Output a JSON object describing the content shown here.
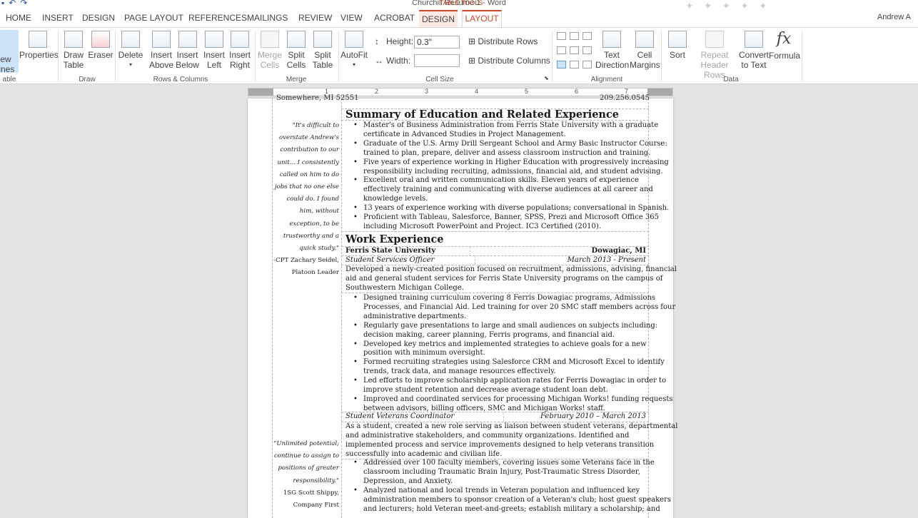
{
  "window": {
    "title": "Churchill Resume 1 - Word",
    "context_group": "TABLE TOOLS",
    "user": "Andrew A"
  },
  "quick_access_icons": [
    "save-icon",
    "undo-icon",
    "redo-icon"
  ],
  "tabs": [
    "HOME",
    "INSERT",
    "DESIGN",
    "PAGE LAYOUT",
    "REFERENCES",
    "MAILINGS",
    "REVIEW",
    "VIEW",
    "ACROBAT",
    "DESIGN",
    "LAYOUT"
  ],
  "active_tab": "LAYOUT",
  "accent_color": "#d24726",
  "ribbon": {
    "table": {
      "view_gridlines_l1": "ew",
      "view_gridlines_l2": "lines",
      "properties": "Properties",
      "group": "able"
    },
    "draw": {
      "draw_table_l1": "Draw",
      "draw_table_l2": "Table",
      "eraser": "Eraser",
      "group": "Draw"
    },
    "rows_columns": {
      "delete": "Delete",
      "insert_above_l1": "Insert",
      "insert_above_l2": "Above",
      "insert_below_l1": "Insert",
      "insert_below_l2": "Below",
      "insert_left_l1": "Insert",
      "insert_left_l2": "Left",
      "insert_right_l1": "Insert",
      "insert_right_l2": "Right",
      "group": "Rows & Columns"
    },
    "merge": {
      "merge_cells_l1": "Merge",
      "merge_cells_l2": "Cells",
      "split_cells_l1": "Split",
      "split_cells_l2": "Cells",
      "split_table_l1": "Split",
      "split_table_l2": "Table",
      "group": "Merge"
    },
    "cell_size": {
      "autofit": "AutoFit",
      "height_label": "Height:",
      "height_value": "0.3\"",
      "width_label": "Width:",
      "width_value": "",
      "distribute_rows": "Distribute Rows",
      "distribute_columns": "Distribute Columns",
      "group": "Cell Size"
    },
    "alignment": {
      "text_direction_l1": "Text",
      "text_direction_l2": "Direction",
      "cell_margins_l1": "Cell",
      "cell_margins_l2": "Margins",
      "group": "Alignment"
    },
    "data": {
      "sort": "Sort",
      "repeat_header_l1": "Repeat",
      "repeat_header_l2": "Header Rows",
      "convert_l1": "Convert",
      "convert_l2": "to Text",
      "formula": "Formula",
      "group": "Data"
    }
  },
  "ruler": {
    "numbers": [
      "1",
      "2",
      "3",
      "4",
      "5",
      "6",
      "7"
    ]
  },
  "document": {
    "header_left": "Somewhere, MI 52551",
    "header_right": "209.256.0545",
    "sections": {
      "summary_title": "Summary of Education and Related Experience",
      "work_title": "Work Experience"
    },
    "summary_bullets": [
      [
        "Master's of Business Administration from Ferris State University with a graduate",
        "certificate in Advanced Studies in Project Management."
      ],
      [
        "Graduate of the U.S. Army Drill Sergeant School and Army Basic Instructor Course:",
        "trained to plan, prepare, deliver and assess classroom instruction and training."
      ],
      [
        "Five years of experience working in Higher Education with progressively increasing",
        "responsibility including recruiting, admissions, financial aid, and student advising."
      ],
      [
        "Excellent oral and written communication skills.  Eleven years of experience",
        "effectively training and communicating with diverse audiences at all career and",
        "knowledge levels."
      ],
      [
        "13 years of experience working with diverse populations; conversational in Spanish."
      ],
      [
        "Proficient with Tableau, Salesforce, Banner, SPSS, Prezi and Microsoft Office 365",
        "including Microsoft PowerPoint and Project. IC3 Certified (2010)."
      ]
    ],
    "employer": {
      "name": "Ferris State University",
      "location": "Dowagiac, MI"
    },
    "job1": {
      "title": "Student Services Officer",
      "dates": "March 2013 - Present",
      "summary": [
        "Developed a newly-created position focused on recruitment, admissions, advising, financial",
        "aid and general student services for Ferris State University programs on the campus of",
        "Southwestern Michigan College."
      ],
      "bullets": [
        [
          "Designed training curriculum covering 8 Ferris Dowagiac programs, Admissions",
          "Processes, and Financial Aid. Led training for over 20 SMC staff members across four",
          "administrative departments."
        ],
        [
          "Regularly gave presentations to large and small audiences on subjects including:",
          "decision making, career planning, Ferris programs, and financial aid."
        ],
        [
          "Developed key metrics and implemented strategies to achieve goals for a new",
          "position with minimum oversight."
        ],
        [
          "Formed recruiting strategies using Salesforce CRM and Microsoft Excel to identify",
          "trends, track data, and manage resources effectively."
        ],
        [
          "Led efforts to improve scholarship application rates for Ferris Dowagiac in order to",
          "improve student retention and decrease average student loan debt."
        ],
        [
          "Improved and coordinated services for processing Michigan Works! funding requests",
          "between advisors, billing officers, SMC and Michigan Works! staff."
        ]
      ]
    },
    "job2": {
      "title": "Student Veterans Coordinator",
      "dates": "February 2010 – March 2013",
      "summary": [
        "As a student, created a new role serving as liaison between student veterans, departmental",
        "and administrative stakeholders, and community organizations. Identified and",
        "implemented process and service improvements designed to help veterans transition",
        "successfully into academic and civilian life."
      ],
      "bullets": [
        [
          "Addressed over 100 faculty members, covering issues some Veterans face in the",
          "classroom including Traumatic Brain Injury, Post-Traumatic Stress Disorder,",
          "Depression, and Anxiety."
        ],
        [
          "Analyzed national and local trends in Veteran population and influenced key",
          "administration members to sponsor creation of a Veteran's club; host guest speakers",
          "and lecturers; hold Veteran meet-and-greets; establish military a scholarship; and"
        ]
      ]
    },
    "quote1": {
      "lines": [
        "\"It's difficult to",
        "overstate Andrew's",
        "contribution to our",
        "unit... I consistently",
        "called on him to do",
        "jobs that no one else",
        "could do. I found",
        "him, without",
        "exception, to be",
        "trustworthy and a",
        "quick study.\""
      ],
      "attr1": "-CPT Zachary Seidel,",
      "attr2": "Platoon Leader"
    },
    "quote2": {
      "lines": [
        "\"Unlimited potential;",
        "continue to assign to",
        "positions of greater",
        "responsibility.\""
      ],
      "attr1": "1SG Scott Shippy,",
      "attr2": "Company First"
    }
  }
}
